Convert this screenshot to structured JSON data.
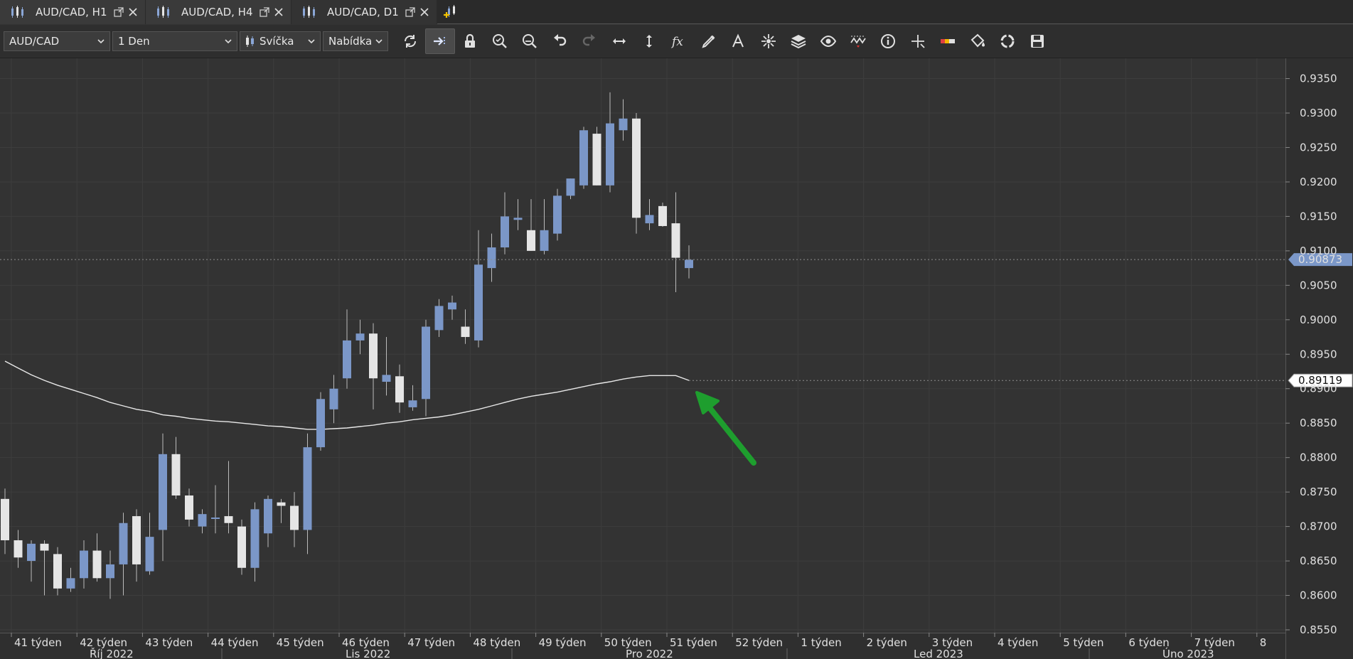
{
  "tabs": [
    {
      "label": "AUD/CAD, H1",
      "active": false
    },
    {
      "label": "AUD/CAD, H4",
      "active": false
    },
    {
      "label": "AUD/CAD, D1",
      "active": true
    }
  ],
  "toolbar": {
    "symbol": "AUD/CAD",
    "timeframe": "1 Den",
    "chart_type": "Svíčka",
    "price_type": "Nabídka",
    "tools": [
      "refresh-icon",
      "scroll-right-icon",
      "lock-icon",
      "zoom-in-icon",
      "zoom-out-icon",
      "undo-icon",
      "redo-icon",
      "horizontal-scale-icon",
      "vertical-scale-icon",
      "indicator-fx-icon",
      "pencil-draw-icon",
      "text-annotation-icon",
      "crosshair-star-icon",
      "layers-icon",
      "eye-icon",
      "wave-icon",
      "info-icon",
      "cursor-cross-icon",
      "ruler-color-icon",
      "paint-bucket-icon",
      "sync-icon",
      "save-icon"
    ]
  },
  "colors": {
    "background": "#333333",
    "grid": "#3d3d3d",
    "bull": "#7b97c8",
    "bear": "#e5e5e5",
    "wick": "#bbbbbb",
    "ma": "#e8e8e8",
    "arrow": "#1e9e2e",
    "current_price_bg": "#7b97c8"
  },
  "chart_data": {
    "type": "candlestick",
    "symbol": "AUD/CAD",
    "timeframe": "D1",
    "ylim": [
      0.855,
      0.9365
    ],
    "y_ticks": [
      "0.9350",
      "0.9300",
      "0.9250",
      "0.9200",
      "0.9150",
      "0.9100",
      "0.9050",
      "0.9000",
      "0.8950",
      "0.8900",
      "0.8850",
      "0.8800",
      "0.8750",
      "0.8700",
      "0.8650",
      "0.8600",
      "0.8550"
    ],
    "week_labels": [
      "41 týden",
      "42 týden",
      "43 týden",
      "44 týden",
      "45 týden",
      "46 týden",
      "47 týden",
      "48 týden",
      "49 týden",
      "50 týden",
      "51 týden",
      "52 týden",
      "1 týden",
      "2 týden",
      "3 týden",
      "4 týden",
      "5 týden",
      "6 týden",
      "7 týden",
      "8"
    ],
    "month_labels": [
      "Říj 2022",
      "Lis 2022",
      "Pro 2022",
      "Led 2023",
      "Úno 2023"
    ],
    "current_price": "0.90873",
    "ma_price": "0.89119",
    "candles": [
      {
        "o": 0.874,
        "h": 0.8755,
        "l": 0.866,
        "c": 0.868
      },
      {
        "o": 0.868,
        "h": 0.8695,
        "l": 0.864,
        "c": 0.8655
      },
      {
        "o": 0.865,
        "h": 0.868,
        "l": 0.862,
        "c": 0.8675
      },
      {
        "o": 0.8675,
        "h": 0.868,
        "l": 0.86,
        "c": 0.8665
      },
      {
        "o": 0.866,
        "h": 0.867,
        "l": 0.86,
        "c": 0.861
      },
      {
        "o": 0.861,
        "h": 0.864,
        "l": 0.8605,
        "c": 0.8625
      },
      {
        "o": 0.8625,
        "h": 0.868,
        "l": 0.861,
        "c": 0.8665
      },
      {
        "o": 0.8665,
        "h": 0.869,
        "l": 0.862,
        "c": 0.8625
      },
      {
        "o": 0.8625,
        "h": 0.8665,
        "l": 0.8595,
        "c": 0.8645
      },
      {
        "o": 0.8645,
        "h": 0.872,
        "l": 0.86,
        "c": 0.8705
      },
      {
        "o": 0.8715,
        "h": 0.8725,
        "l": 0.862,
        "c": 0.8645
      },
      {
        "o": 0.8635,
        "h": 0.872,
        "l": 0.863,
        "c": 0.8685
      },
      {
        "o": 0.8695,
        "h": 0.8835,
        "l": 0.865,
        "c": 0.8805
      },
      {
        "o": 0.8805,
        "h": 0.883,
        "l": 0.874,
        "c": 0.8745
      },
      {
        "o": 0.8745,
        "h": 0.8755,
        "l": 0.87,
        "c": 0.871
      },
      {
        "o": 0.87,
        "h": 0.8725,
        "l": 0.869,
        "c": 0.8718
      },
      {
        "o": 0.8713,
        "h": 0.876,
        "l": 0.869,
        "c": 0.8713
      },
      {
        "o": 0.8715,
        "h": 0.8795,
        "l": 0.869,
        "c": 0.8705
      },
      {
        "o": 0.87,
        "h": 0.871,
        "l": 0.863,
        "c": 0.864
      },
      {
        "o": 0.864,
        "h": 0.8735,
        "l": 0.862,
        "c": 0.8725
      },
      {
        "o": 0.869,
        "h": 0.8745,
        "l": 0.867,
        "c": 0.874
      },
      {
        "o": 0.8735,
        "h": 0.874,
        "l": 0.8705,
        "c": 0.873
      },
      {
        "o": 0.873,
        "h": 0.875,
        "l": 0.867,
        "c": 0.8695
      },
      {
        "o": 0.8695,
        "h": 0.8835,
        "l": 0.866,
        "c": 0.8815
      },
      {
        "o": 0.8815,
        "h": 0.8895,
        "l": 0.881,
        "c": 0.8885
      },
      {
        "o": 0.887,
        "h": 0.892,
        "l": 0.885,
        "c": 0.89
      },
      {
        "o": 0.8915,
        "h": 0.9015,
        "l": 0.89,
        "c": 0.897
      },
      {
        "o": 0.897,
        "h": 0.9,
        "l": 0.895,
        "c": 0.898
      },
      {
        "o": 0.898,
        "h": 0.8995,
        "l": 0.887,
        "c": 0.8915
      },
      {
        "o": 0.891,
        "h": 0.8975,
        "l": 0.889,
        "c": 0.892
      },
      {
        "o": 0.8918,
        "h": 0.8935,
        "l": 0.8865,
        "c": 0.888
      },
      {
        "o": 0.8873,
        "h": 0.8905,
        "l": 0.8868,
        "c": 0.8883
      },
      {
        "o": 0.8885,
        "h": 0.9,
        "l": 0.886,
        "c": 0.899
      },
      {
        "o": 0.8985,
        "h": 0.903,
        "l": 0.8975,
        "c": 0.902
      },
      {
        "o": 0.9015,
        "h": 0.9035,
        "l": 0.9,
        "c": 0.9025
      },
      {
        "o": 0.899,
        "h": 0.9015,
        "l": 0.8965,
        "c": 0.8975
      },
      {
        "o": 0.897,
        "h": 0.913,
        "l": 0.896,
        "c": 0.908
      },
      {
        "o": 0.9075,
        "h": 0.9125,
        "l": 0.9055,
        "c": 0.9105
      },
      {
        "o": 0.9105,
        "h": 0.9185,
        "l": 0.9095,
        "c": 0.915
      },
      {
        "o": 0.9145,
        "h": 0.9175,
        "l": 0.913,
        "c": 0.9148
      },
      {
        "o": 0.913,
        "h": 0.9175,
        "l": 0.91,
        "c": 0.91
      },
      {
        "o": 0.91,
        "h": 0.9175,
        "l": 0.9095,
        "c": 0.913
      },
      {
        "o": 0.9125,
        "h": 0.919,
        "l": 0.9115,
        "c": 0.918
      },
      {
        "o": 0.918,
        "h": 0.9205,
        "l": 0.9175,
        "c": 0.9205
      },
      {
        "o": 0.9195,
        "h": 0.928,
        "l": 0.919,
        "c": 0.9275
      },
      {
        "o": 0.927,
        "h": 0.928,
        "l": 0.9195,
        "c": 0.9195
      },
      {
        "o": 0.9195,
        "h": 0.933,
        "l": 0.9185,
        "c": 0.9285
      },
      {
        "o": 0.9275,
        "h": 0.932,
        "l": 0.926,
        "c": 0.9292
      },
      {
        "o": 0.9292,
        "h": 0.93,
        "l": 0.9125,
        "c": 0.9148
      },
      {
        "o": 0.914,
        "h": 0.9175,
        "l": 0.913,
        "c": 0.9152
      },
      {
        "o": 0.9165,
        "h": 0.917,
        "l": 0.9135,
        "c": 0.9136
      },
      {
        "o": 0.914,
        "h": 0.9185,
        "l": 0.904,
        "c": 0.909
      },
      {
        "o": 0.9075,
        "h": 0.9108,
        "l": 0.906,
        "c": 0.9087
      }
    ],
    "moving_average": [
      0.894,
      0.893,
      0.892,
      0.8912,
      0.8905,
      0.8899,
      0.8893,
      0.8887,
      0.888,
      0.8875,
      0.887,
      0.8867,
      0.8862,
      0.886,
      0.8857,
      0.8855,
      0.8853,
      0.8852,
      0.885,
      0.8848,
      0.8846,
      0.8845,
      0.8843,
      0.8841,
      0.8841,
      0.8842,
      0.8843,
      0.8845,
      0.8847,
      0.885,
      0.8852,
      0.8855,
      0.8857,
      0.8859,
      0.8862,
      0.8866,
      0.887,
      0.8875,
      0.888,
      0.8885,
      0.8889,
      0.8892,
      0.8895,
      0.8899,
      0.8903,
      0.8907,
      0.891,
      0.8914,
      0.8917,
      0.8919,
      0.8919,
      0.8919,
      0.8912
    ]
  }
}
